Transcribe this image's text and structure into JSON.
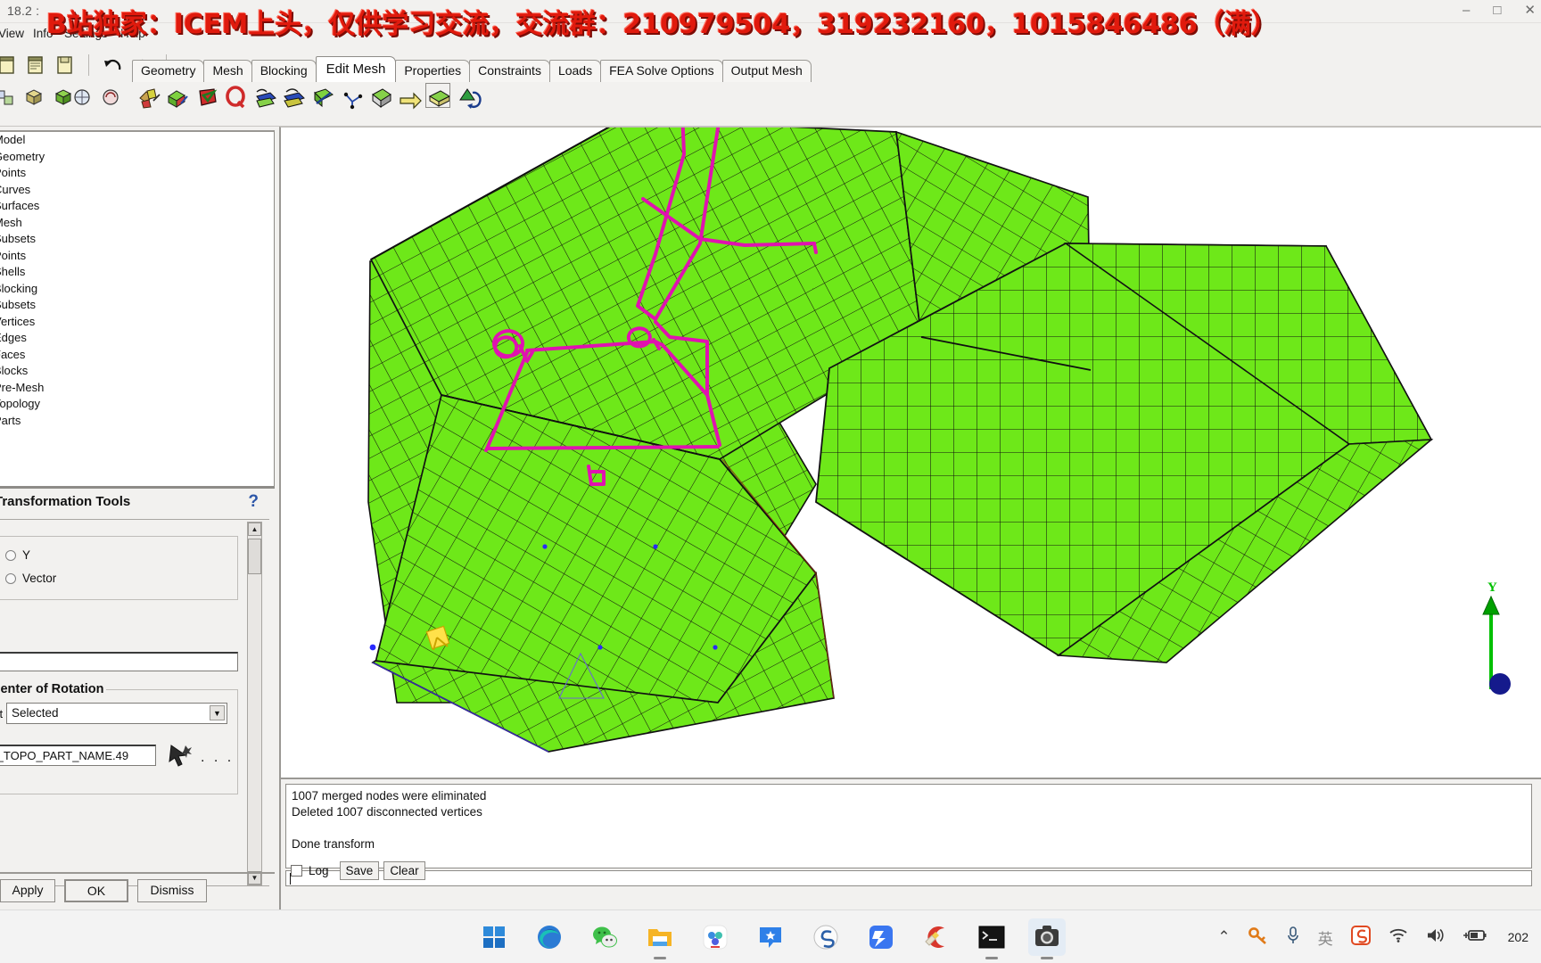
{
  "window": {
    "title": "18.2 :",
    "minimize": "–",
    "maximize": "□",
    "close": "✕"
  },
  "overlay": {
    "banner": "B站独家：ICEM上头，仅供学习交流，交流群：210979504，319232160，1015846486（满）",
    "color": "#e01a0d"
  },
  "menu": {
    "items": [
      "View",
      "Info",
      "Settings",
      "Help"
    ]
  },
  "tabs": [
    {
      "label": "Geometry",
      "active": false
    },
    {
      "label": "Mesh",
      "active": false
    },
    {
      "label": "Blocking",
      "active": false
    },
    {
      "label": "Edit Mesh",
      "active": true
    },
    {
      "label": "Properties",
      "active": false
    },
    {
      "label": "Constraints",
      "active": false
    },
    {
      "label": "Loads",
      "active": false
    },
    {
      "label": "FEA Solve Options",
      "active": false
    },
    {
      "label": "Output Mesh",
      "active": false
    }
  ],
  "toolbar": {
    "file_icons": [
      "new-file-icon",
      "open-file-icon",
      "save-file-icon"
    ],
    "history_icons": [
      "undo-icon",
      "redo-icon"
    ],
    "row2_icons": [
      "measure-icon",
      "transform-translate-icon",
      "transform-rotate-icon",
      "merge-nodes-icon",
      "extrude-mesh-icon",
      "smooth-mesh-icon",
      "check-mesh-icon",
      "quality-histogram-icon",
      "repair-mesh-icon",
      "split-mesh-icon",
      "move-nodes-icon",
      "create-element-icon",
      "delete-element-icon",
      "renumber-icon",
      "mesh-info-icon"
    ]
  },
  "tree": {
    "items": [
      "Model",
      "Geometry",
      "Points",
      "Curves",
      "Surfaces",
      "Mesh",
      "Subsets",
      "Points",
      "Shells",
      "Blocking",
      "Subsets",
      "Vertices",
      "Edges",
      "Faces",
      "Blocks",
      "Pre-Mesh",
      "Topology",
      "Parts"
    ]
  },
  "panel": {
    "title": "Transformation Tools",
    "help_icon": "?",
    "axis_group": {
      "options": [
        {
          "label": "Y",
          "selected": false
        },
        {
          "label": "Vector",
          "selected": false
        }
      ]
    },
    "vector_field": "",
    "rotation_group_label": "Center of Rotation",
    "method_label": "ent",
    "method_value": "Selected",
    "part_field": "P_TOPO_PART_NAME.49",
    "select_icon": "select-cursor-icon",
    "more_button": ". . .",
    "buttons": [
      {
        "label": "Apply"
      },
      {
        "label": "OK"
      },
      {
        "label": "Dismiss"
      }
    ]
  },
  "messages": {
    "lines": [
      "1007 merged nodes were eliminated",
      "Deleted 1007 disconnected vertices",
      "",
      "Done transform"
    ],
    "input_value": "",
    "log_checkbox_label": "Log",
    "log_checked": false,
    "save_label": "Save",
    "clear_label": "Clear"
  },
  "viewport": {
    "axis_label_y": "Y",
    "mesh_color": "#6ee819",
    "mesh_line_color": "#1a1a1a",
    "annotation_color": "#e012b0",
    "background": "#ffffff"
  },
  "taskbar": {
    "apps": [
      {
        "name": "windows-start-icon",
        "active": false,
        "running": false
      },
      {
        "name": "edge-browser-icon",
        "active": false,
        "running": false
      },
      {
        "name": "wechat-icon",
        "active": false,
        "running": false
      },
      {
        "name": "file-explorer-icon",
        "active": false,
        "running": true
      },
      {
        "name": "baidu-netdisk-icon",
        "active": false,
        "running": false
      },
      {
        "name": "tim-qq-icon",
        "active": false,
        "running": false
      },
      {
        "name": "sogou-browser-icon",
        "active": false,
        "running": false
      },
      {
        "name": "thunder-download-icon",
        "active": false,
        "running": false
      },
      {
        "name": "ccleaner-icon",
        "active": false,
        "running": false
      },
      {
        "name": "terminal-icon",
        "active": false,
        "running": true
      },
      {
        "name": "screen-recorder-icon",
        "active": true,
        "running": true
      }
    ],
    "tray": [
      {
        "name": "chevron-up-icon",
        "glyph": "⌃"
      },
      {
        "name": "key-icon",
        "glyph": "🔑"
      },
      {
        "name": "microphone-icon",
        "glyph": "🎙"
      },
      {
        "name": "ime-english-icon",
        "glyph": "英"
      },
      {
        "name": "sogou-input-icon",
        "glyph": "S"
      },
      {
        "name": "wifi-icon",
        "glyph": "📶"
      },
      {
        "name": "volume-icon",
        "glyph": "🔊"
      },
      {
        "name": "battery-icon",
        "glyph": "🔋"
      }
    ],
    "clock": "202"
  }
}
